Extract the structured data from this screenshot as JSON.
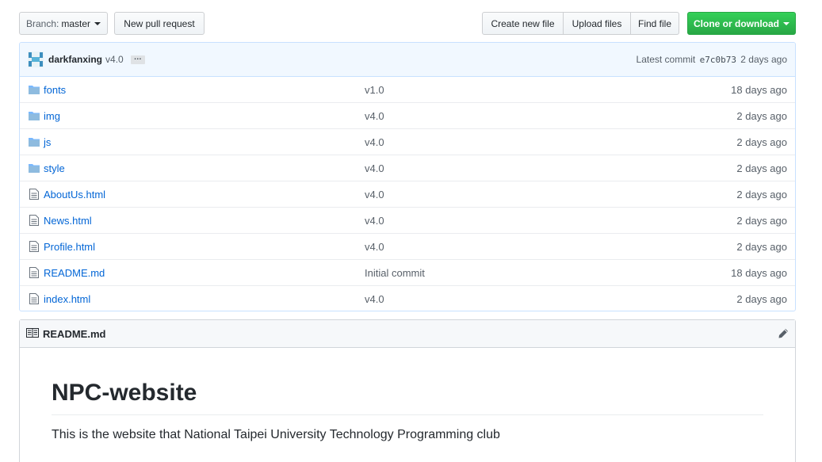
{
  "toolbar": {
    "branch_label": "Branch:",
    "branch_value": "master",
    "new_pr": "New pull request",
    "create_file": "Create new file",
    "upload_files": "Upload files",
    "find_file": "Find file",
    "clone": "Clone or download"
  },
  "commit": {
    "author": "darkfanxing",
    "message": "v4.0",
    "ellipsis": "…",
    "latest_label": "Latest commit",
    "sha": "e7c0b73",
    "age": "2 days ago"
  },
  "files": [
    {
      "type": "dir",
      "name": "fonts",
      "message": "v1.0",
      "age": "18 days ago"
    },
    {
      "type": "dir",
      "name": "img",
      "message": "v4.0",
      "age": "2 days ago"
    },
    {
      "type": "dir",
      "name": "js",
      "message": "v4.0",
      "age": "2 days ago"
    },
    {
      "type": "dir",
      "name": "style",
      "message": "v4.0",
      "age": "2 days ago"
    },
    {
      "type": "file",
      "name": "AboutUs.html",
      "message": "v4.0",
      "age": "2 days ago"
    },
    {
      "type": "file",
      "name": "News.html",
      "message": "v4.0",
      "age": "2 days ago"
    },
    {
      "type": "file",
      "name": "Profile.html",
      "message": "v4.0",
      "age": "2 days ago"
    },
    {
      "type": "file",
      "name": "README.md",
      "message": "Initial commit",
      "age": "18 days ago"
    },
    {
      "type": "file",
      "name": "index.html",
      "message": "v4.0",
      "age": "2 days ago"
    }
  ],
  "readme": {
    "filename": "README.md",
    "heading": "NPC-website",
    "paragraph": "This is the website that National Taipei University Technology Programming club"
  },
  "colors": {
    "link": "#0366d6",
    "clone_button": "#28a745",
    "commit_bar": "#f1f8ff",
    "folder_icon": "#79b8ff"
  },
  "icons": {
    "dir": "folder-icon",
    "file": "file-icon",
    "readme": "book-icon",
    "edit": "pencil-icon"
  }
}
